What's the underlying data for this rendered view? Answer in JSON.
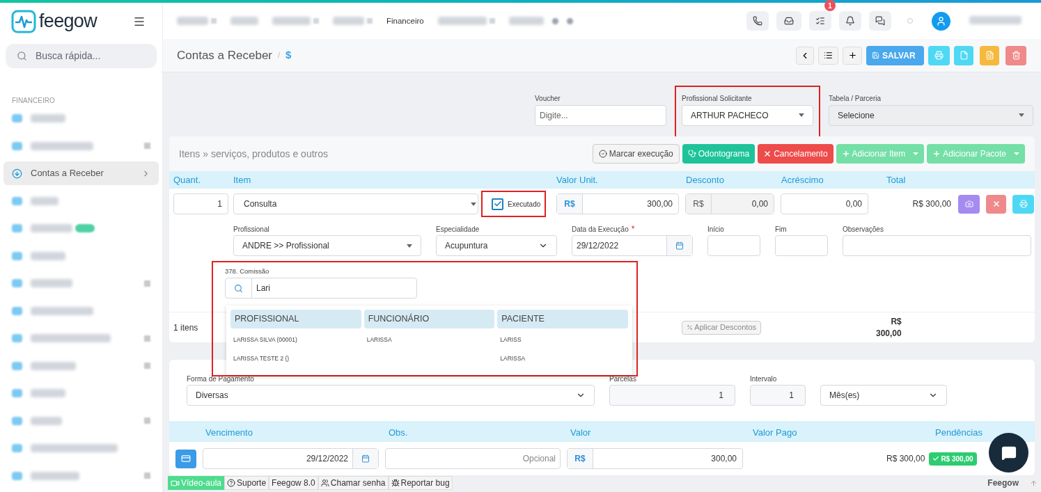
{
  "brand": {
    "name": "feegow"
  },
  "search": {
    "placeholder": "Busca rápida..."
  },
  "top_nav": [
    {
      "kind": "redacted",
      "arrow": true
    },
    {
      "kind": "redacted",
      "arrow": false
    },
    {
      "kind": "redacted",
      "arrow": true
    },
    {
      "kind": "redacted",
      "arrow": true
    },
    {
      "kind": "link",
      "label": "Financeiro"
    },
    {
      "kind": "redacted",
      "arrow": true
    },
    {
      "kind": "redacted",
      "arrow": false
    },
    {
      "kind": "dot"
    },
    {
      "kind": "dot"
    }
  ],
  "header_badge": "1",
  "sidebar": {
    "section": "FINANCEIRO",
    "items": [
      {
        "kind": "redacted",
        "selected": false,
        "arrow": false
      },
      {
        "kind": "redacted",
        "selected": false,
        "arrow": true
      },
      {
        "kind": "link",
        "label": "Contas a Receber",
        "selected": true,
        "arrow": true
      },
      {
        "kind": "redacted",
        "selected": false,
        "arrow": false
      },
      {
        "kind": "redacted",
        "selected": false,
        "arrow": false,
        "tag": true
      },
      {
        "kind": "redacted",
        "selected": false,
        "arrow": false
      },
      {
        "kind": "redacted",
        "selected": false,
        "arrow": true
      },
      {
        "kind": "redacted",
        "selected": false,
        "arrow": false
      },
      {
        "kind": "redacted",
        "selected": false,
        "arrow": true
      },
      {
        "kind": "redacted",
        "selected": false,
        "arrow": true
      },
      {
        "kind": "redacted",
        "selected": false,
        "arrow": false
      },
      {
        "kind": "redacted",
        "selected": false,
        "arrow": true
      },
      {
        "kind": "redacted",
        "selected": false,
        "arrow": false
      },
      {
        "kind": "redacted",
        "selected": false,
        "arrow": true
      }
    ]
  },
  "page": {
    "title": "Contas a Receber",
    "separator": "/",
    "icon_text": "$",
    "save": "SALVAR"
  },
  "fields": [
    {
      "kind": "input",
      "label": "Voucher",
      "placeholder": "Digite...",
      "highlighted": false
    },
    {
      "kind": "select",
      "label": "Profissional Solicitante",
      "value": "ARTHUR PACHECO",
      "disabled": false,
      "highlighted": true
    },
    {
      "kind": "select",
      "label": "Tabela / Parceria",
      "value": "Selecione",
      "disabled": true,
      "highlighted": false
    }
  ],
  "items_panel": {
    "title": "Itens » serviços, produtos e outros",
    "buttons": [
      {
        "kind": "outline",
        "label": "Marcar execução",
        "dropdown": false
      },
      {
        "kind": "teal",
        "label": "Odontograma",
        "dropdown": false
      },
      {
        "kind": "danger",
        "label": "Cancelamento",
        "dropdown": false
      },
      {
        "kind": "add",
        "label": "Adicionar Item",
        "dropdown": true
      },
      {
        "kind": "add",
        "label": "Adicionar Pacote",
        "dropdown": true
      }
    ],
    "columns": [
      "Quant.",
      "Item",
      "Valor Unit.",
      "Desconto",
      "Acréscimo",
      "Total"
    ],
    "row": {
      "quantity": "1",
      "item": "Consulta",
      "executed_label": "Executado",
      "executed": true,
      "unit_currency": "R$",
      "unit_value": "300,00",
      "discount_currency": "R$",
      "discount": "0,00",
      "addition": "0,00",
      "total": "R$ 300,00"
    },
    "details": {
      "professional_label": "Profissional",
      "professional": "ANDRE >> Profissional",
      "specialty_label": "Especialidade",
      "specialty": "Acupuntura",
      "date_label": "Data da Execução",
      "date_required": true,
      "required_mark": "*",
      "date": "29/12/2022",
      "start_label": "Início",
      "end_label": "Fim",
      "notes_label": "Observações"
    },
    "commission": {
      "label": "378. Comissão",
      "query": "Lari",
      "columns": [
        "PROFISSIONAL",
        "FUNCIONÁRIO",
        "PACIENTE"
      ],
      "rows": [
        {
          "professional": "LARISSA SILVA (00001)",
          "employee": "LARISSA",
          "patient": "LARISS"
        },
        {
          "professional": "LARISSA TESTE 2 ()",
          "patient": "LARISSA"
        }
      ]
    },
    "summary": {
      "count": "1 itens",
      "discount_button": "Aplicar Descontos",
      "total_currency": "R$",
      "total": "300,00"
    }
  },
  "payment": {
    "method_label": "Forma de Pagamento",
    "method": "Diversas",
    "installments_label": "Parcelas",
    "installments": "1",
    "interval_label": "Intervalo",
    "interval": "1",
    "unit": "Mês(es)",
    "columns": [
      "Vencimento",
      "Obs.",
      "Valor",
      "Valor Pago",
      "Pendências"
    ],
    "rows": [
      {
        "due": "29/12/2022",
        "notes_placeholder": "Opcional",
        "currency": "R$",
        "value": "300,00",
        "pending": "R$ 300,00",
        "status": "R$ 300,00"
      }
    ]
  },
  "footer": {
    "buttons": [
      {
        "kind": "video",
        "label": "Vídeo-aula"
      },
      {
        "kind": "help",
        "label": "Suporte"
      },
      {
        "kind": "plain",
        "label": "Feegow 8.0"
      },
      {
        "kind": "users",
        "label": "Chamar senha"
      },
      {
        "kind": "bug",
        "label": "Reportar bug"
      }
    ],
    "brand": "Feegow"
  }
}
